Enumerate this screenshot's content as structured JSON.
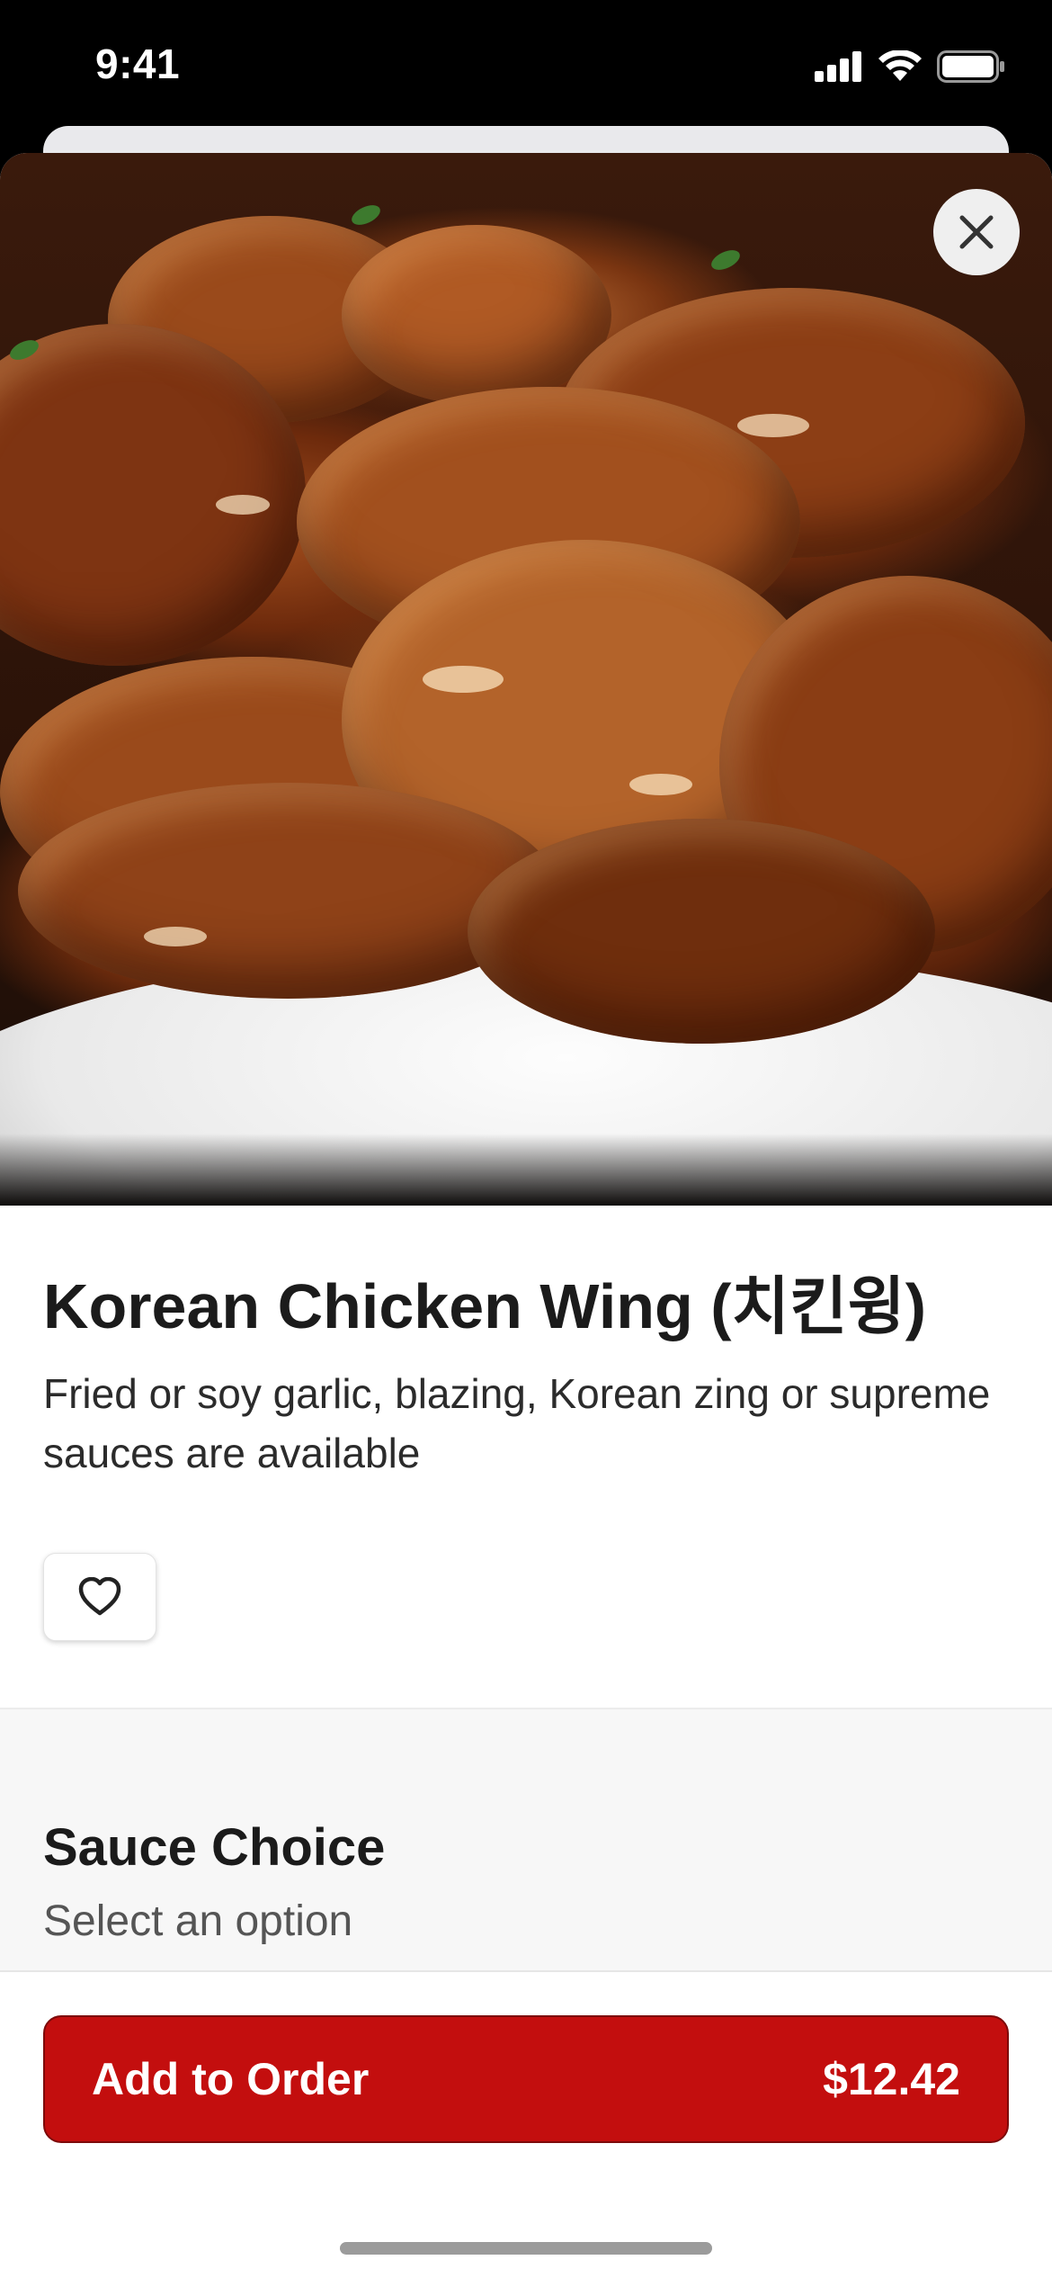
{
  "status_bar": {
    "time": "9:41"
  },
  "item": {
    "title": "Korean Chicken Wing (치킨윙)",
    "description": "Fried or soy garlic, blazing, Korean zing or supreme sauces are available"
  },
  "icons": {
    "close": "close-icon",
    "favorite": "heart-icon",
    "signal": "signal-icon",
    "wifi": "wifi-icon",
    "battery": "battery-icon"
  },
  "options": {
    "section_title": "Sauce Choice",
    "section_subtitle": "Select an option"
  },
  "footer": {
    "add_label": "Add to Order",
    "price": "$12.42"
  },
  "colors": {
    "primary": "#c30e0e",
    "text": "#1b1b1b",
    "section_bg": "#f7f7f7"
  }
}
